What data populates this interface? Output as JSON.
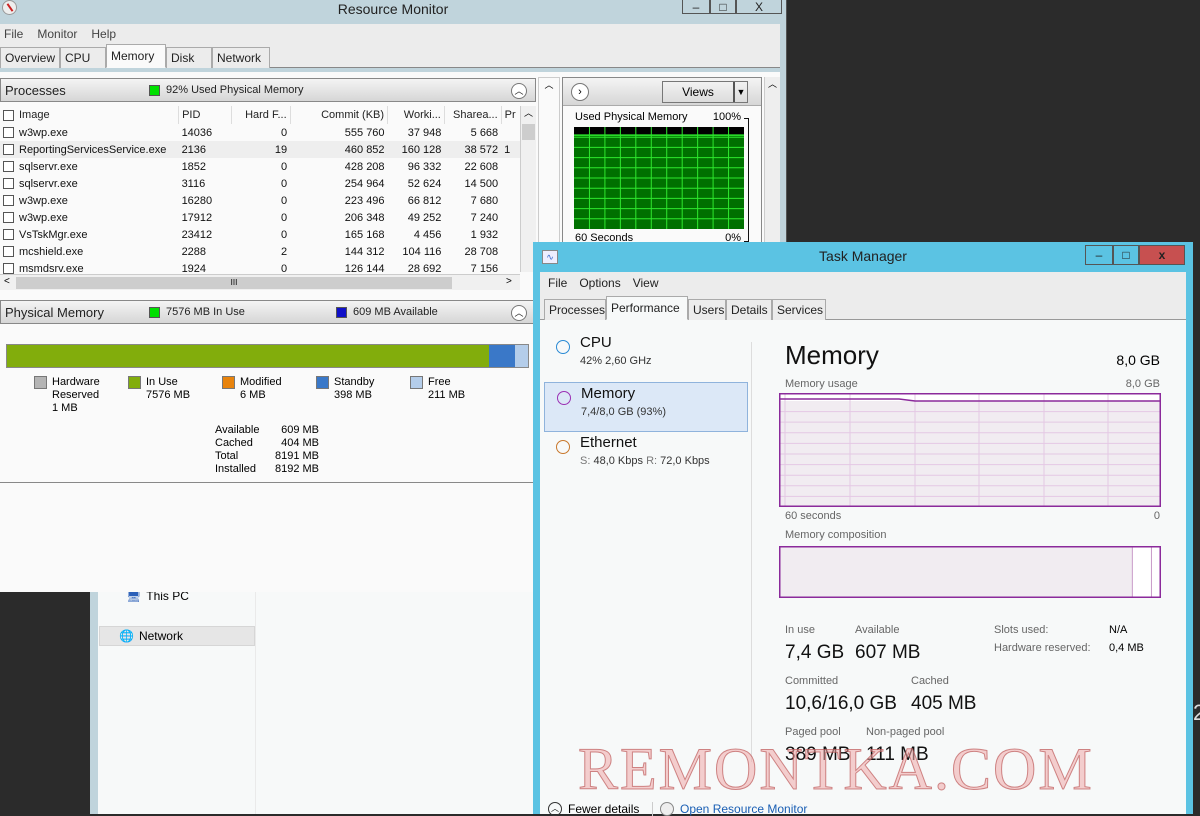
{
  "explorer": {
    "items": [
      {
        "label": "This PC",
        "icon": "computer-icon"
      },
      {
        "label": "Network",
        "icon": "network-icon"
      }
    ]
  },
  "resmon": {
    "title": "Resource Monitor",
    "window_buttons": [
      "–",
      "□",
      "X"
    ],
    "menu": [
      "File",
      "Monitor",
      "Help"
    ],
    "tabs": [
      "Overview",
      "CPU",
      "Memory",
      "Disk",
      "Network"
    ],
    "active_tab": "Memory",
    "processes": {
      "title": "Processes",
      "status": "92% Used Physical Memory",
      "status_color": "#00e000",
      "columns": [
        "Image",
        "PID",
        "Hard F...",
        "Commit (KB)",
        "Worki...",
        "Sharea...",
        "Pr"
      ],
      "rows": [
        {
          "image": "w3wp.exe",
          "pid": "14036",
          "hard": "0",
          "commit": "555 760",
          "working": "37 948",
          "shareable": "5 668",
          "pr": ""
        },
        {
          "image": "ReportingServicesService.exe",
          "pid": "2136",
          "hard": "19",
          "commit": "460 852",
          "working": "160 128",
          "shareable": "38 572",
          "pr": "1"
        },
        {
          "image": "sqlservr.exe",
          "pid": "1852",
          "hard": "0",
          "commit": "428 208",
          "working": "96 332",
          "shareable": "22 608",
          "pr": ""
        },
        {
          "image": "sqlservr.exe",
          "pid": "3116",
          "hard": "0",
          "commit": "254 964",
          "working": "52 624",
          "shareable": "14 500",
          "pr": ""
        },
        {
          "image": "w3wp.exe",
          "pid": "16280",
          "hard": "0",
          "commit": "223 496",
          "working": "66 812",
          "shareable": "7 680",
          "pr": ""
        },
        {
          "image": "w3wp.exe",
          "pid": "17912",
          "hard": "0",
          "commit": "206 348",
          "working": "49 252",
          "shareable": "7 240",
          "pr": ""
        },
        {
          "image": "VsTskMgr.exe",
          "pid": "23412",
          "hard": "0",
          "commit": "165 168",
          "working": "4 456",
          "shareable": "1 932",
          "pr": ""
        },
        {
          "image": "mcshield.exe",
          "pid": "2288",
          "hard": "2",
          "commit": "144 312",
          "working": "104 116",
          "shareable": "28 708",
          "pr": ""
        },
        {
          "image": "msmdsrv.exe",
          "pid": "1924",
          "hard": "0",
          "commit": "126 144",
          "working": "28 692",
          "shareable": "7 156",
          "pr": ""
        }
      ]
    },
    "physical_memory": {
      "title": "Physical Memory",
      "in_use_label": "7576 MB In Use",
      "available_label": "609 MB Available",
      "bar_mb": {
        "hardware_reserved": 1,
        "in_use": 7576,
        "modified": 6,
        "standby": 398,
        "free": 211
      },
      "legend": [
        {
          "name": "Hardware Reserved",
          "line1": "Hardware",
          "line2": "Reserved",
          "value": "1 MB",
          "color": "#b4b4b4"
        },
        {
          "name": "In Use",
          "line1": "In Use",
          "line2": "",
          "value": "7576 MB",
          "color": "#82ad0c"
        },
        {
          "name": "Modified",
          "line1": "Modified",
          "line2": "",
          "value": "6 MB",
          "color": "#e8830c"
        },
        {
          "name": "Standby",
          "line1": "Standby",
          "line2": "",
          "value": "398 MB",
          "color": "#3a78c8"
        },
        {
          "name": "Free",
          "line1": "Free",
          "line2": "",
          "value": "211 MB",
          "color": "#b4cdea"
        }
      ],
      "stats": [
        {
          "label": "Available",
          "value": "609 MB"
        },
        {
          "label": "Cached",
          "value": "404 MB"
        },
        {
          "label": "Total",
          "value": "8191 MB"
        },
        {
          "label": "Installed",
          "value": "8192 MB"
        }
      ]
    },
    "graph": {
      "views_label": "Views",
      "title": "Used Physical Memory",
      "max_label": "100%",
      "min_label": "0%",
      "time_label": "60 Seconds",
      "used_percent": 92
    }
  },
  "taskmgr": {
    "title": "Task Manager",
    "window_buttons": [
      "–",
      "□",
      "x"
    ],
    "menu": [
      "File",
      "Options",
      "View"
    ],
    "tabs": [
      "Processes",
      "Performance",
      "Users",
      "Details",
      "Services"
    ],
    "active_tab": "Performance",
    "sidebar": [
      {
        "name": "CPU",
        "sub": "42% 2,60 GHz",
        "color": "#2a8ad4"
      },
      {
        "name": "Memory",
        "sub": "7,4/8,0 GB (93%)",
        "color": "#9b30b4"
      },
      {
        "name": "Ethernet",
        "sub_s": "S:",
        "sub_s_val": "48,0 Kbps",
        "sub_r": "R:",
        "sub_r_val": "72,0 Kbps",
        "color": "#c8782c"
      }
    ],
    "memory": {
      "heading": "Memory",
      "total": "8,0 GB",
      "usage_label": "Memory usage",
      "usage_max": "8,0 GB",
      "time_left": "60 seconds",
      "time_right": "0",
      "composition_label": "Memory composition",
      "usage_percent": 93,
      "composition": {
        "in_use_gb": 7.4,
        "standby_gb": 0.4,
        "free_gb": 0.2
      },
      "stats": {
        "in_use_label": "In use",
        "in_use": "7,4 GB",
        "available_label": "Available",
        "available": "607 MB",
        "committed_label": "Committed",
        "committed": "10,6/16,0 GB",
        "cached_label": "Cached",
        "cached": "405 MB",
        "paged_label": "Paged pool",
        "paged": "389 MB",
        "nonpaged_label": "Non-paged pool",
        "nonpaged": "111 MB",
        "slots_label": "Slots used:",
        "slots": "N/A",
        "hwres_label": "Hardware reserved:",
        "hwres": "0,4 MB"
      }
    },
    "footer": {
      "fewer": "Fewer details",
      "open_resmon": "Open Resource Monitor"
    }
  },
  "watermark": "REMONTKA.COM"
}
